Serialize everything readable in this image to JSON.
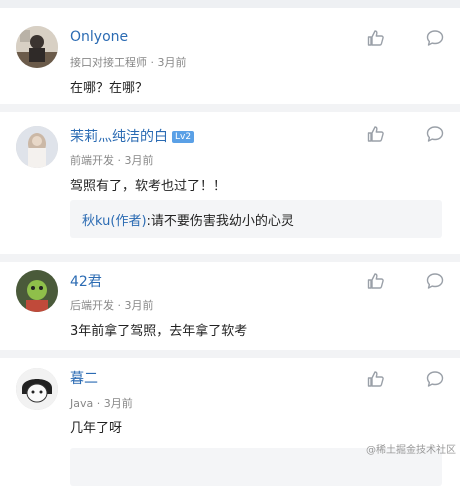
{
  "comments": [
    {
      "name": "Onlyone",
      "badge": "",
      "meta": "接口对接工程师 · 3月前",
      "text": "在哪？在哪？",
      "avatar_icon": "avatar-onlyone"
    },
    {
      "name": "茉莉灬纯洁的白",
      "badge": "Lv2",
      "meta": "前端开发 · 3月前",
      "text": "驾照有了，软考也过了！！",
      "reply_author": "秋ku(作者)",
      "reply_body": ":请不要伤害我幼小的心灵",
      "avatar_icon": "avatar-moli"
    },
    {
      "name": "42君",
      "badge": "",
      "meta": "后端开发 · 3月前",
      "text": "3年前拿了驾照，去年拿了软考",
      "avatar_icon": "avatar-42"
    },
    {
      "name": "暮二",
      "badge": "",
      "meta": "Java · 3月前",
      "text": "几年了呀",
      "avatar_icon": "avatar-muer"
    }
  ],
  "watermark": "@稀土掘金技术社区",
  "colors": {
    "name": "#2b6bb3",
    "meta": "#888888",
    "separator": "#f2f3f5",
    "reply_bg": "#f4f5f7"
  }
}
